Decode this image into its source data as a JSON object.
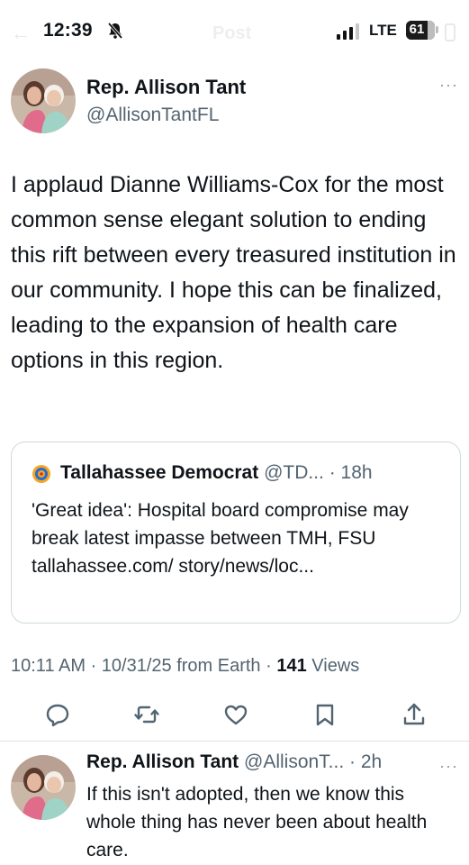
{
  "status_bar": {
    "time": "12:39",
    "network": "LTE",
    "battery": "61",
    "battery_level_percent": 61,
    "header_back_label": "←",
    "header_title": "Post"
  },
  "post": {
    "author_name": "Rep. Allison Tant",
    "author_handle": "@AllisonTantFL",
    "text": "I applaud Dianne Williams-Cox for the most common sense elegant solution to ending this rift between every treasured institution in our community.  I hope this can be finalized, leading to the expansion of health care options in this region.",
    "more_label": "···",
    "quote": {
      "source_name": "Tallahassee Democrat",
      "source_meta": " @TD... · 18h",
      "text": "'Great idea': Hospital board compromise may break latest impasse between TMH, FSU tallahassee.com/ story/news/loc..."
    },
    "timestamp": "10:11 AM · 10/31/25 from Earth · ",
    "views_count": "141",
    "views_label": " Views"
  },
  "actions": {
    "icons": [
      "reply-icon",
      "repost-icon",
      "like-icon",
      "bookmark-icon",
      "share-icon"
    ],
    "color": "#536471"
  },
  "reply": {
    "author_name": "Rep. Allison Tant",
    "meta": " @AllisonT... · 2h",
    "more_label": "···",
    "text": "If this isn't adopted, then we know this whole thing has never been about health care."
  },
  "colors": {
    "text": "#0f1419",
    "secondary": "#536471",
    "border": "#cfd9de"
  }
}
